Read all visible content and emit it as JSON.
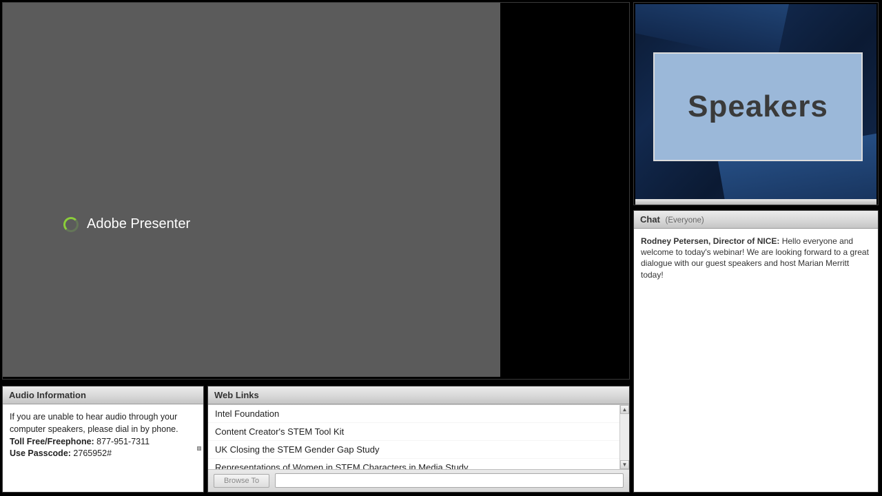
{
  "main": {
    "loading_label": "Adobe Presenter"
  },
  "speakers": {
    "card_title": "Speakers"
  },
  "chat": {
    "title": "Chat",
    "scope": "(Everyone)",
    "messages": [
      {
        "sender": "Rodney Petersen, Director of NICE:",
        "text": " Hello everyone and welcome to today's webinar!  We are looking forward to a great dialogue with our guest speakers and host Marian Merritt today!"
      }
    ]
  },
  "audio": {
    "title": "Audio Information",
    "intro": "If you are unable to hear audio through your computer speakers, please dial in by phone.",
    "toll_label": "Toll Free/Freephone:",
    "toll_value": " 877-951-7311",
    "pass_label": "Use Passcode:",
    "pass_value": " 2765952#"
  },
  "links": {
    "title": "Web Links",
    "items": [
      "Intel Foundation",
      "Content Creator's STEM Tool Kit",
      "UK Closing the STEM Gender Gap Study",
      "Representations of Women in STEM Characters in Media Study"
    ],
    "browse_label": "Browse To",
    "url_value": ""
  }
}
